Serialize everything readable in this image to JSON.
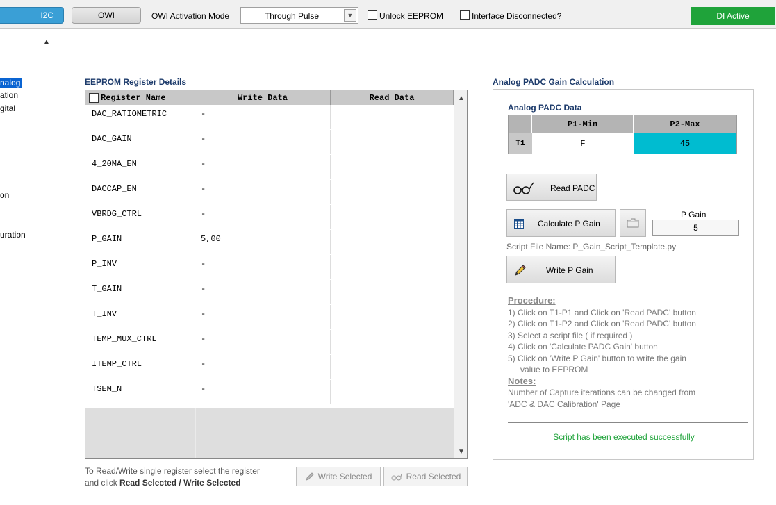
{
  "toolbar": {
    "i2c_label": "I2C",
    "owi_label": "OWI",
    "activation_label": "OWI Activation Mode",
    "activation_value": "Through Pulse",
    "unlock_label": "Unlock EEPROM",
    "disconnected_label": "Interface Disconnected?",
    "status_label": "DI Active",
    "status_color": "#1fa33a"
  },
  "sidebar": {
    "items": [
      {
        "label": "nalog",
        "selected": true
      },
      {
        "label": "ation"
      },
      {
        "label": "gital"
      },
      {
        "label": "on"
      },
      {
        "label": "uration"
      }
    ]
  },
  "eeprom": {
    "title": "EEPROM Register Details",
    "columns": [
      "Register Name",
      "Write Data",
      "Read Data"
    ],
    "rows": [
      {
        "name": "DAC_RATIOMETRIC",
        "write": "-",
        "read": ""
      },
      {
        "name": "DAC_GAIN",
        "write": "-",
        "read": ""
      },
      {
        "name": "4_20MA_EN",
        "write": "-",
        "read": ""
      },
      {
        "name": "DACCAP_EN",
        "write": "-",
        "read": ""
      },
      {
        "name": "VBRDG_CTRL",
        "write": "-",
        "read": ""
      },
      {
        "name": "P_GAIN",
        "write": "5,00",
        "read": ""
      },
      {
        "name": "P_INV",
        "write": "-",
        "read": ""
      },
      {
        "name": "T_GAIN",
        "write": "-",
        "read": ""
      },
      {
        "name": "T_INV",
        "write": "-",
        "read": ""
      },
      {
        "name": "TEMP_MUX_CTRL",
        "write": "-",
        "read": ""
      },
      {
        "name": "ITEMP_CTRL",
        "write": "-",
        "read": ""
      },
      {
        "name": "TSEM_N",
        "write": "-",
        "read": ""
      }
    ],
    "hint_line1": "To Read/Write single register select the register",
    "hint_line2_prefix": "and click ",
    "hint_line2_bold": "Read Selected / Write Selected",
    "write_selected_label": "Write Selected",
    "read_selected_label": "Read Selected"
  },
  "padc": {
    "title": "Analog PADC Gain Calculation",
    "data_title": "Analog PADC Data",
    "columns": [
      "P1-Min",
      "P2-Max"
    ],
    "row_label": "T1",
    "row_values": [
      "F",
      "45"
    ],
    "highlight_color": "#00bcd0",
    "read_padc_label": "Read PADC",
    "calc_label": "Calculate P Gain",
    "pgain_label": "P Gain",
    "pgain_value": "5",
    "script_file": "Script File Name: P_Gain_Script_Template.py",
    "write_label": "Write P Gain",
    "procedure_title": "Procedure:",
    "procedure": [
      "1) Click on T1-P1 and  Click on 'Read PADC' button",
      "2) Click on T1-P2 and Click on 'Read PADC' button",
      "3) Select a script file ( if required )",
      "4) Click on 'Calculate PADC Gain' button",
      "5) Click on 'Write P Gain' button to write the gain",
      "    value to EEPROM"
    ],
    "notes_title": "Notes:",
    "notes": [
      "Number of Capture iterations can be changed from",
      "'ADC & DAC Calibration' Page"
    ],
    "status": "Script has been executed successfully"
  }
}
